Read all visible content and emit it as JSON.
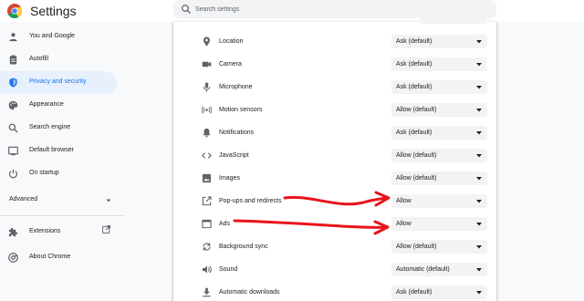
{
  "header": {
    "title": "Settings",
    "search_placeholder": "Search settings"
  },
  "sidebar": {
    "items": [
      {
        "label": "You and Google",
        "icon": "person-icon"
      },
      {
        "label": "Autofill",
        "icon": "clipboard-icon"
      },
      {
        "label": "Privacy and security",
        "icon": "shield-icon",
        "active": true
      },
      {
        "label": "Appearance",
        "icon": "palette-icon"
      },
      {
        "label": "Search engine",
        "icon": "search-icon"
      },
      {
        "label": "Default browser",
        "icon": "browser-icon"
      },
      {
        "label": "On startup",
        "icon": "power-icon"
      }
    ],
    "advanced_label": "Advanced",
    "bottom_items": [
      {
        "label": "Extensions",
        "icon": "puzzle-icon"
      },
      {
        "label": "About Chrome",
        "icon": "chrome-icon"
      }
    ]
  },
  "permissions": [
    {
      "label": "Location",
      "value": "Ask (default)",
      "icon": "location-pin-icon"
    },
    {
      "label": "Camera",
      "value": "Ask (default)",
      "icon": "camera-icon"
    },
    {
      "label": "Microphone",
      "value": "Ask (default)",
      "icon": "microphone-icon"
    },
    {
      "label": "Motion sensors",
      "value": "Allow (default)",
      "icon": "motion-sensor-icon"
    },
    {
      "label": "Notifications",
      "value": "Ask (default)",
      "icon": "bell-icon"
    },
    {
      "label": "JavaScript",
      "value": "Allow (default)",
      "icon": "code-icon"
    },
    {
      "label": "Images",
      "value": "Allow (default)",
      "icon": "image-icon"
    },
    {
      "label": "Pop-ups and redirects",
      "value": "Allow",
      "icon": "external-link-icon"
    },
    {
      "label": "Ads",
      "value": "Allow",
      "icon": "window-icon"
    },
    {
      "label": "Background sync",
      "value": "Allow (default)",
      "icon": "sync-icon"
    },
    {
      "label": "Sound",
      "value": "Automatic (default)",
      "icon": "speaker-icon"
    },
    {
      "label": "Automatic downloads",
      "value": "Ask (default)",
      "icon": "download-icon"
    }
  ],
  "colors": {
    "accent": "#1a73e8",
    "active_bg": "#e8f0fe",
    "annotation": "#e8141b"
  }
}
